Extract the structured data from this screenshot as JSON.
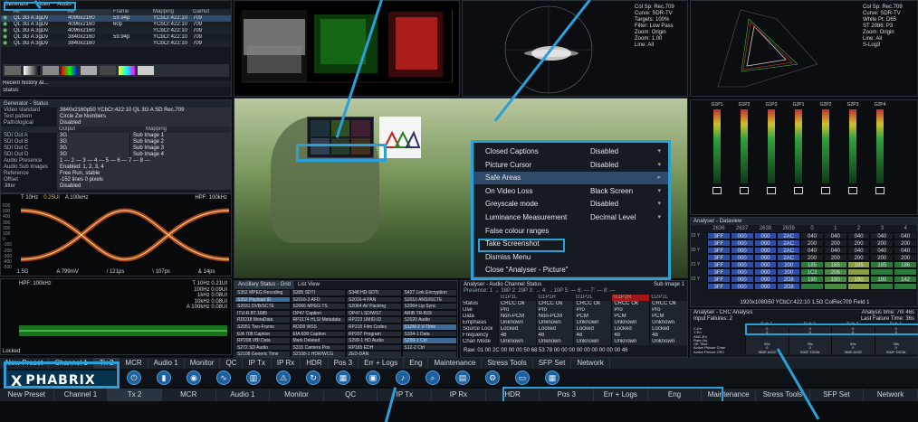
{
  "top_left": {
    "tabs": [
      "Generator",
      "Video",
      "Audio"
    ],
    "col_headers": [
      "",
      "All",
      "All",
      "Frame",
      "Mapping",
      "Gamut"
    ],
    "rows": [
      [
        "QL 3G A 3gDv",
        "4096x2160",
        "59.94p",
        "YCbCr:422:10",
        "709"
      ],
      [
        "QL 3G A 3gDv",
        "4096x2160",
        "60p",
        "YCbCr:422:10",
        "709"
      ],
      [
        "QL 3G A 3gDv",
        "4096x2160",
        "",
        "YCbCr:422:10",
        "709"
      ],
      [
        "QL 3G A 3gDv",
        "3840x2160",
        "59.94p",
        "YCbCr:422:10",
        "709"
      ],
      [
        "QL 3G A 3gDv",
        "3840x2160",
        "",
        "YCbCr:422:10",
        "709"
      ]
    ],
    "recent_history": "Recent history &l...",
    "status": "Status:"
  },
  "generator_status": {
    "title": "Generator - Status",
    "rows": [
      {
        "k": "Video standard",
        "v": "3840x2160p50 YCbCr:422:10 QL 3G A SD Rec.709"
      },
      {
        "k": "Test pattern",
        "v": "Circle Zw Numbers"
      },
      {
        "k": "Pathological",
        "v": "Disabled"
      }
    ],
    "out_headers": [
      "",
      "Output",
      "Mapping"
    ],
    "outputs": [
      {
        "k": "SDI Out A",
        "o": "3G",
        "m": "Sub Image 1"
      },
      {
        "k": "SDI Out B",
        "o": "3G",
        "m": "Sub Image 2"
      },
      {
        "k": "SDI Out C",
        "o": "3G",
        "m": "Sub Image 3"
      },
      {
        "k": "SDI Out D",
        "o": "3G",
        "m": "Sub Image 4"
      }
    ],
    "extra": [
      {
        "k": "Audio Presence",
        "v": "1 — 2 — 3 — 4 — 5 — 6 — 7 — 8 —"
      },
      {
        "k": "Audio Sub Images",
        "v": "Enabled: 1, 2, 3, 4"
      },
      {
        "k": "Reference",
        "v": "Free Run, stable"
      },
      {
        "k": "Offset",
        "v": "-152 lines 0 pixels"
      },
      {
        "k": "Jitter",
        "v": "Disabled"
      }
    ]
  },
  "jitter_eye": {
    "header_left": "T 10Hz",
    "header_mid": "0.25UI",
    "header_mid2": "A 100kHz",
    "header_right": "HPF: 100kHz",
    "yticks": [
      "600",
      "500",
      "400",
      "300",
      "200",
      "100",
      "0",
      "-100",
      "-200",
      "-300",
      "-400",
      "-500"
    ],
    "footer": [
      "A 799mV",
      "/ 121ps",
      "\\ 107ps",
      "& 14ps"
    ],
    "footer_left": "1.5G"
  },
  "jitter_meter": {
    "title": "HPF: 100kHz",
    "values": [
      "T 10Hz 0.21UI",
      "100Hz 0.09UI",
      "1kHz 0.08UI",
      "10kHz 0.08UI",
      "A 100kHz 0.08UI"
    ],
    "yticks": [
      "0.4",
      "0.3",
      "0.2",
      "0.1",
      "0.0",
      "-0.1",
      "-0.2",
      "-0.3",
      "-0.4"
    ],
    "locked": "Locked"
  },
  "vectorscope": {
    "lines": [
      "Col Sp: Rec.709",
      "Curve: SDR-TV",
      "Targets: 100%",
      "Filter: Low Pass",
      "Zoom: Origin",
      "Zoom: 1.00",
      "Line: All"
    ]
  },
  "cie": {
    "lines": [
      "Col Sp: Rec.709",
      "Curve: SDR-TV",
      "White Pt: D65",
      "ST 2086: P3",
      "Zoom: Origin",
      "Line: All",
      "S-Log3"
    ]
  },
  "picture_menu": {
    "items": [
      {
        "label": "Closed Captions",
        "value": "Disabled"
      },
      {
        "label": "Picture Cursor",
        "value": "Disabled"
      },
      {
        "label": "Safe Areas",
        "value": ""
      },
      {
        "label": "On Video Loss",
        "value": "Black Screen"
      },
      {
        "label": "Greyscale mode",
        "value": "Disabled"
      },
      {
        "label": "Luminance Measurement",
        "value": "Decimal Level"
      },
      {
        "label": "False colour ranges",
        "value": ""
      },
      {
        "label": "Take Screenshot",
        "value": ""
      },
      {
        "label": "Dismiss Menu",
        "value": ""
      },
      {
        "label": "Close \"Analyser - Picture\"",
        "value": ""
      }
    ]
  },
  "audio_meters": {
    "channels": [
      "G1P1",
      "G1P2",
      "G1P3",
      "G2P1",
      "G2P2",
      "G2P3",
      "G2P4"
    ]
  },
  "dataview": {
    "title": "Analyser - Dataview",
    "col_headers": [
      "2636",
      "2637",
      "2638",
      "2639",
      "0",
      "1",
      "2",
      "3",
      "4"
    ],
    "row_labels": [
      "19 Y",
      "20 Y",
      "21 Y",
      "22 Y"
    ],
    "values": [
      [
        "3FF",
        "000",
        "000",
        "2AC",
        "040",
        "040",
        "040",
        "040",
        "040"
      ],
      [
        "3FF",
        "000",
        "000",
        "2AC",
        "200",
        "200",
        "200",
        "200",
        "200"
      ],
      [
        "3FF",
        "000",
        "000",
        "2AC",
        "040",
        "040",
        "040",
        "040",
        "040"
      ],
      [
        "3FF",
        "000",
        "000",
        "2AC",
        "200",
        "200",
        "200",
        "200",
        "200"
      ],
      [
        "3FF",
        "000",
        "000",
        "200",
        "185",
        "185",
        "185",
        "185",
        "186"
      ],
      [
        "3FF",
        "000",
        "000",
        "200",
        "1C3",
        "206",
        "",
        "",
        ""
      ],
      [
        "3FF",
        "000",
        "000",
        "2D8",
        "190",
        "190",
        "190",
        "190",
        "142"
      ],
      [
        "3FF",
        "000",
        "000",
        "2D8",
        "",
        "",
        "",
        "",
        ""
      ]
    ],
    "footer": "1920x1080i50 YCbCr:422:10 1.5G ColRec709 Field 1"
  },
  "ancillary": {
    "tabs": [
      "Ancillary Status - Grid",
      "List View"
    ],
    "cells": [
      [
        "S352 MPEG Recoding",
        "S305 SDTI",
        "S348 HD-SDTI",
        "S427 Link Encryption"
      ],
      [
        "S352 Payload ID",
        "S2016-3 AFD",
        "S2016-4 PAN",
        "S2010 ANSI/SCTE"
      ],
      [
        "S2031 DVB/SCTE",
        "S2066 MPEG TS",
        "S2064 AV Packing",
        "S2064 Lip Sync"
      ],
      [
        "ITU-R BT.1685",
        "OP47 Caption",
        "OP47 LSD/WST",
        "ARIB TR-B29"
      ],
      [
        "RDD18 MetaData",
        "RP2174 HLSI Metadata",
        "RP223 UMID-ID",
        "S2020 Audio"
      ],
      [
        "S2051 Two-Frame",
        "RDD8 WSS",
        "RP215 Film Codes",
        "S12M-2 V-Time"
      ],
      [
        "EIA 708 Caption",
        "EIA 608 Caption",
        "RP207 Program",
        "S334-1 Data"
      ],
      [
        "RP208 VBI Data",
        "Mark Deleted",
        "S299-1 HD Audio",
        "S299-1 Ctrl"
      ],
      [
        "S272 SD Audio",
        "S315 Camera Pos",
        "RP165 EDH",
        "S12-2 Ctrl"
      ],
      [
        "S2108 Generic Time",
        "S2108-1 HDR/WCG",
        "ZED-DAN",
        ""
      ]
    ]
  },
  "audio_channel": {
    "title": "Analyser - Audio Channel Status",
    "sub": "Sub Image 1",
    "presence": "Presence: 1 → 18P   2: 29P   3: →   4: →10P   5: —   6: —   7: —   8: —",
    "col_headers": [
      "",
      "G1P1L",
      "G1P1R",
      "G1P2L",
      "G1P2R",
      "G2P1L"
    ],
    "rows": [
      [
        "Status",
        "CRCC Ok",
        "CRCC Ok",
        "CRCC Ok",
        "CRCC Ok",
        "CRCC Ok"
      ],
      [
        "Use",
        "Pro",
        "Pro",
        "Pro",
        "Pro",
        "Pro"
      ],
      [
        "Data",
        "Non-PCM",
        "Non-PCM",
        "PCM",
        "PCM",
        "PCM"
      ],
      [
        "Emphasis",
        "Unknown",
        "Unknown",
        "Unknown",
        "Unknown",
        "Unknown"
      ],
      [
        "Source Lock",
        "Locked",
        "Locked",
        "Locked",
        "Locked",
        "Locked"
      ],
      [
        "Frequency",
        "48",
        "48",
        "48",
        "48",
        "48"
      ],
      [
        "Chan Mode",
        "Unknown",
        "Unknown",
        "Unknown",
        "Unknown",
        "Unknown"
      ]
    ],
    "raw": "Raw: 01 00 2C 00      00 00 50 68      53 78 00 00      00 00 00 00      00 00 00 46"
  },
  "crc": {
    "title": "Analyser - CRC Analysis",
    "failures": "Input Failures: 2",
    "analysis_time": "Analysis time: 7m 46s",
    "last_failure": "Last Failure Time: 36s",
    "subs": [
      "Sub 1",
      "Sub 2",
      "Sub 3",
      "Sub 4"
    ],
    "rows": [
      {
        "k": "C-Err",
        "v": [
          "0",
          "0",
          "0",
          "0"
        ]
      },
      {
        "k": "Y-Err",
        "v": [
          "0",
          "0",
          "0",
          "0"
        ]
      },
      {
        "k": "ANC-Err",
        "v": [
          "",
          "",
          "",
          ""
        ]
      },
      {
        "k": "Rate (/s)",
        "v": [
          "",
          "",
          "",
          ""
        ]
      },
      {
        "k": "OK Time",
        "v": [
          "39s",
          "39s",
          "39s",
          "39s"
        ]
      },
      {
        "k": "Active Picture Chan",
        "v": [
          "0",
          "0",
          "0",
          "0"
        ]
      },
      {
        "k": "Active Picture CRC",
        "v": [
          "360E A922",
          "B32F DD3A",
          "360E A922",
          "B32F DD3A"
        ]
      }
    ]
  },
  "preset_bar": {
    "tabs": [
      "New Preset",
      "Channel 1",
      "Tx 2",
      "MCR",
      "Audio 1",
      "Monitor",
      "QC",
      "IP Tx",
      "IP Rx",
      "HDR",
      "Pos 3",
      "Err + Logs",
      "Eng",
      "Maintenance",
      "Stress Tools",
      "SFP Set",
      "Network"
    ]
  },
  "bottom_bar": {
    "tabs": [
      "New Preset",
      "Channel 1",
      "Tx 2",
      "MCR",
      "Audio 1",
      "Monitor",
      "QC",
      "IP Tx",
      "IP Rx",
      "HDR",
      "Pos 3",
      "Err + Logs",
      "Eng",
      "Maintenance",
      "Stress Tools",
      "SFP Set",
      "Network"
    ]
  },
  "brand": {
    "logo": "PHABRIX",
    "accent": "#2a9fd8"
  }
}
